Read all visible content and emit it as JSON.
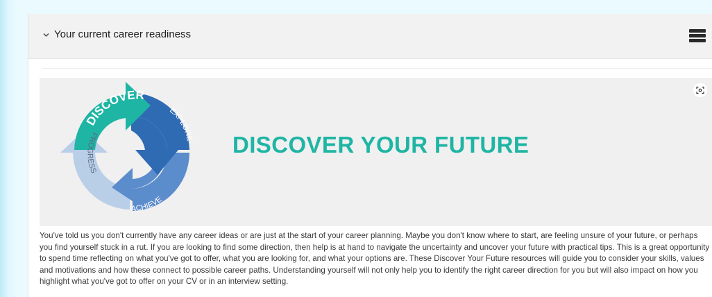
{
  "section": {
    "title": "Your current career readiness",
    "chevron_icon": "chevron-down-icon",
    "menu_icon": "menu-stack-icon"
  },
  "banner": {
    "title": "DISCOVER YOUR FUTURE",
    "cycle_labels": {
      "discover": "DISCOVER",
      "explore": "EXPLORE",
      "achieve": "ACHIEVE",
      "progress": "PROGRESS"
    },
    "focus_icon": "focus-scan-icon"
  },
  "description": "You've told us you don't currently have any career ideas or are just at the start of your career planning. Maybe you don't know where to start, are feeling unsure of your future, or perhaps you find yourself stuck in a rut. If you are looking to find some direction, then help is at hand to navigate the uncertainty and uncover your future with practical tips. This is a great opportunity to spend time reflecting on what you've got to offer, what you are looking for, and what your options are. These Discover Your Future resources will guide you to consider your skills, values and motivations and how these connect to possible career paths. Understanding yourself will not only help you to identify the right career direction for you but will also impact on how you highlight what you've got to offer on your CV or in an interview setting.",
  "colors": {
    "teal": "#1fb5a4",
    "dark_blue": "#2f6bb3",
    "mid_blue": "#5b8ccc",
    "light_blue": "#b9cfe8"
  }
}
